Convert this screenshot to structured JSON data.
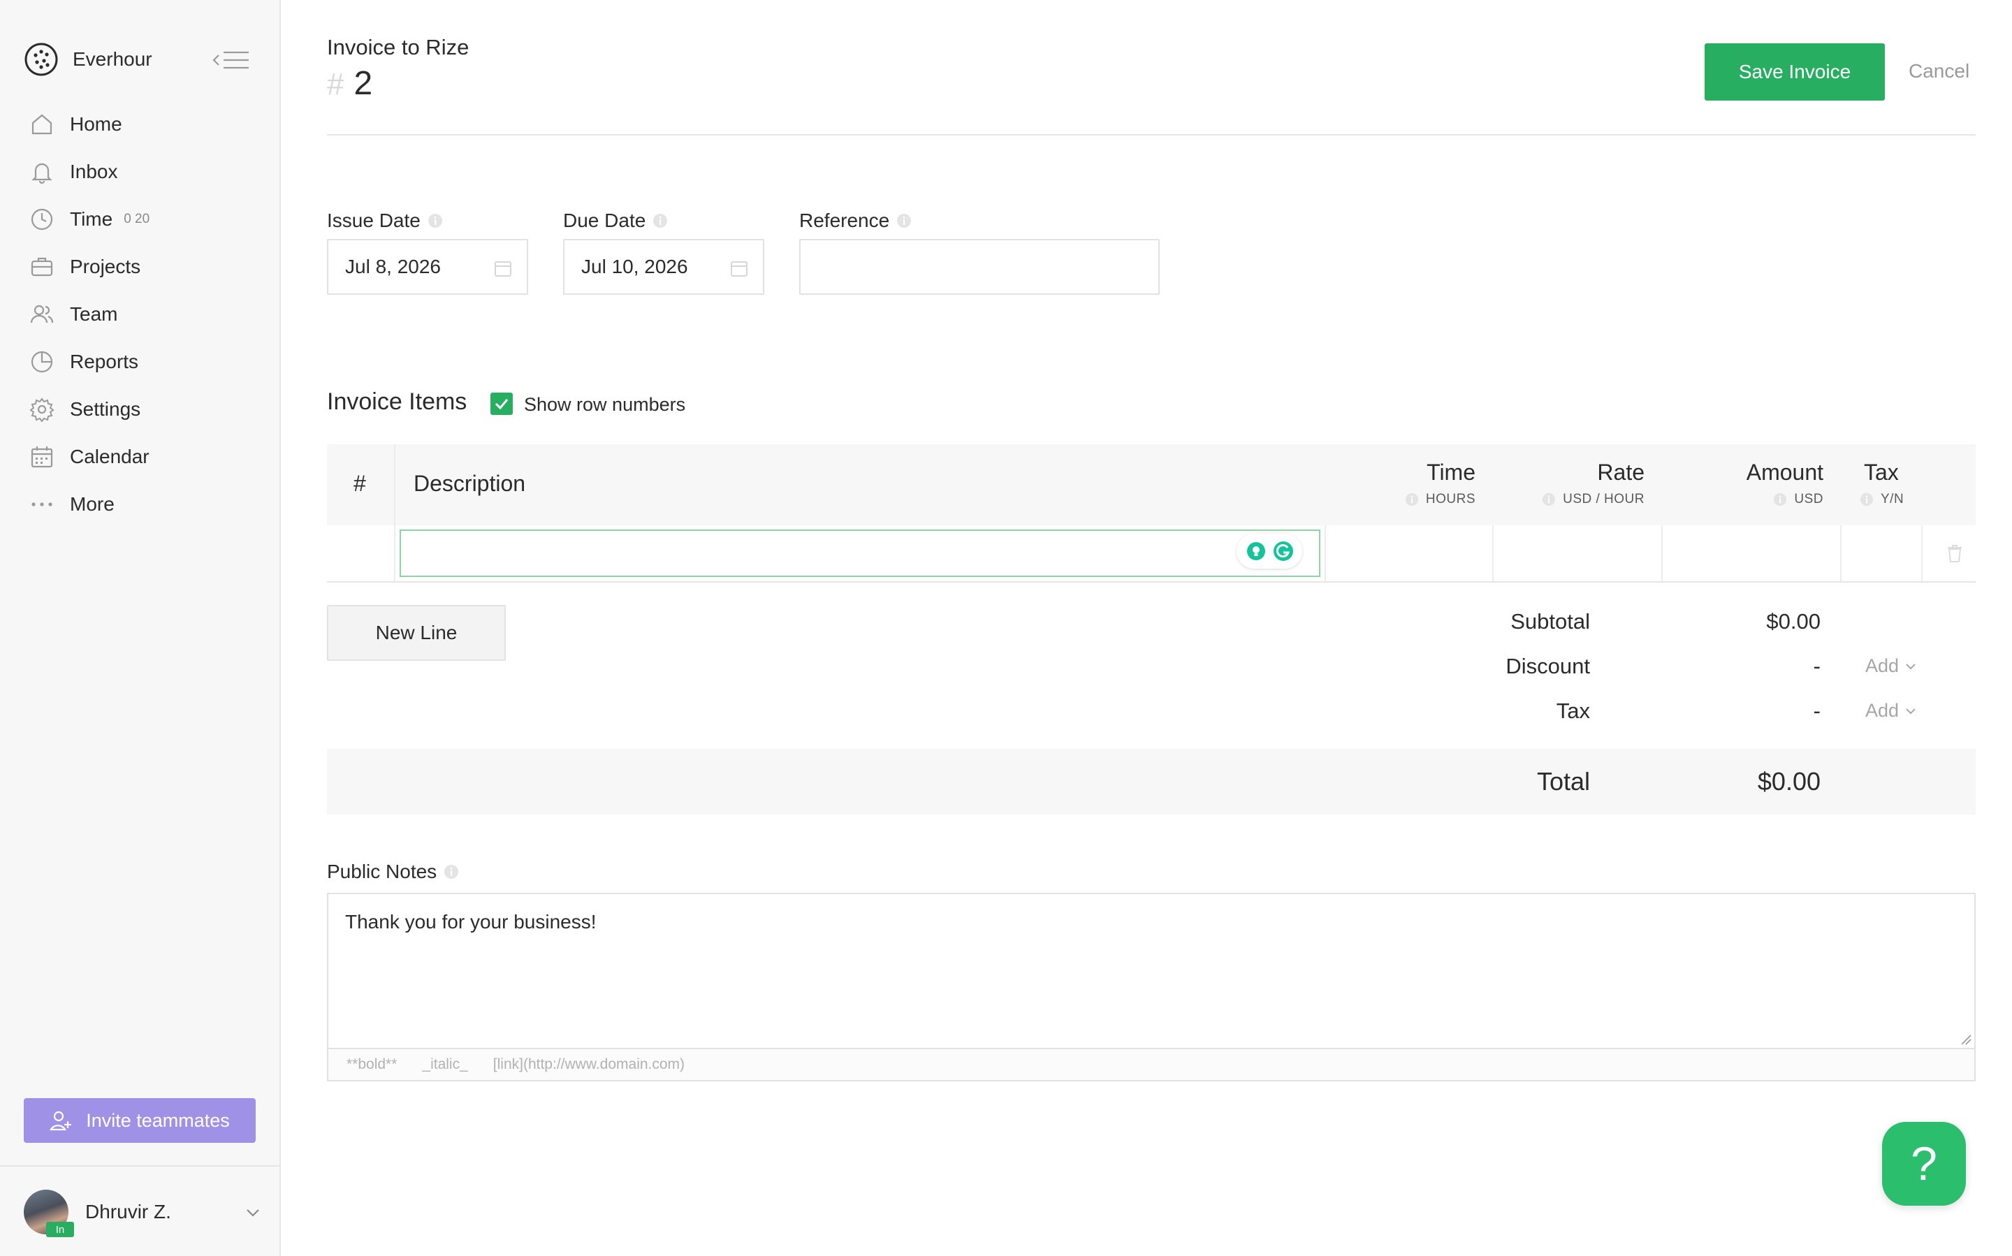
{
  "app": {
    "name": "Everhour"
  },
  "sidebar": {
    "items": [
      {
        "label": "Home",
        "icon": "home-icon"
      },
      {
        "label": "Inbox",
        "icon": "bell-icon"
      },
      {
        "label": "Time",
        "icon": "clock-icon",
        "badge": "0 20"
      },
      {
        "label": "Projects",
        "icon": "briefcase-icon"
      },
      {
        "label": "Team",
        "icon": "people-icon"
      },
      {
        "label": "Reports",
        "icon": "pie-chart-icon"
      },
      {
        "label": "Settings",
        "icon": "gear-icon"
      },
      {
        "label": "Calendar",
        "icon": "calendar-icon"
      },
      {
        "label": "More",
        "icon": "more-dots-icon"
      }
    ],
    "invite_label": "Invite teammates",
    "user": {
      "name": "Dhruvir Z.",
      "status_badge": "In"
    }
  },
  "invoice": {
    "title": "Invoice to Rize",
    "hash": "#",
    "number": "2",
    "save_label": "Save Invoice",
    "cancel_label": "Cancel"
  },
  "fields": {
    "issue_date": {
      "label": "Issue Date",
      "value": "Jul 8, 2026"
    },
    "due_date": {
      "label": "Due Date",
      "value": "Jul 10, 2026"
    },
    "reference": {
      "label": "Reference",
      "value": ""
    }
  },
  "items": {
    "title": "Invoice Items",
    "show_row_numbers_label": "Show row numbers",
    "show_row_numbers": true,
    "columns": {
      "num": "#",
      "description": "Description",
      "time": {
        "label": "Time",
        "unit": "HOURS"
      },
      "rate": {
        "label": "Rate",
        "unit": "USD / HOUR"
      },
      "amount": {
        "label": "Amount",
        "unit": "USD"
      },
      "tax": {
        "label": "Tax",
        "unit": "Y/N"
      }
    },
    "rows": [
      {
        "description": "",
        "time": "",
        "rate": "",
        "amount": "",
        "tax": ""
      }
    ],
    "new_line_label": "New Line"
  },
  "summary": {
    "subtotal_label": "Subtotal",
    "subtotal_value": "$0.00",
    "discount_label": "Discount",
    "discount_value": "-",
    "discount_add": "Add",
    "tax_label": "Tax",
    "tax_value": "-",
    "tax_add": "Add",
    "total_label": "Total",
    "total_value": "$0.00"
  },
  "notes": {
    "label": "Public Notes",
    "value": "Thank you for your business!",
    "hints": [
      "**bold**",
      "_italic_",
      "[link](http://www.domain.com)"
    ]
  },
  "help": {
    "label": "?"
  },
  "colors": {
    "accent_green": "#27ae60",
    "invite_purple": "#9e91e6",
    "sidebar_bg": "#f7f7f7"
  }
}
